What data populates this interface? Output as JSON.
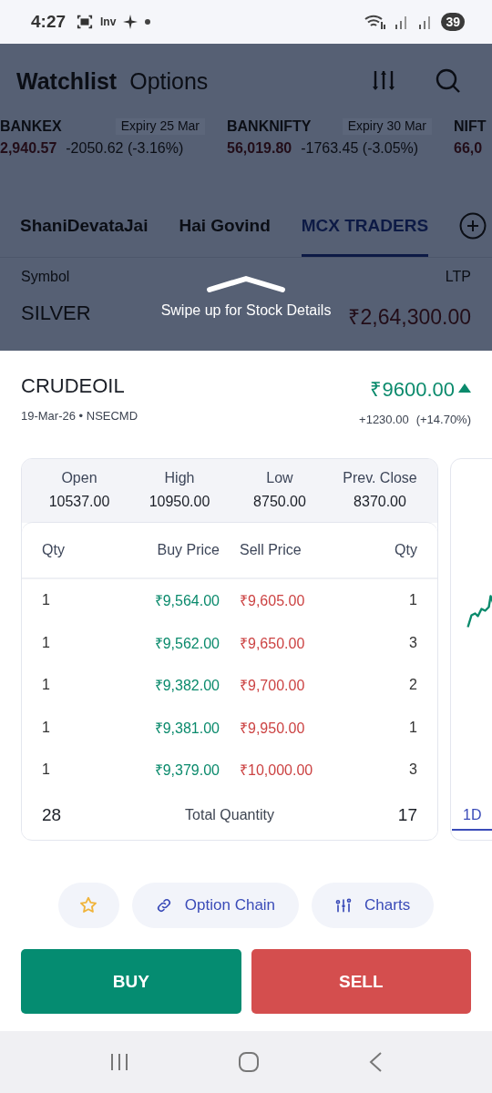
{
  "status_bar": {
    "time": "4:27",
    "app_badge": "Inv",
    "battery": "39"
  },
  "app_header": {
    "tabs": [
      {
        "label": "Watchlist",
        "selected": true
      },
      {
        "label": "Options",
        "selected": false
      }
    ]
  },
  "tickers": [
    {
      "symbol": "BANKEX",
      "expiry": "Expiry 25 Mar",
      "price": "2,940.57",
      "change": "-2050.62 (-3.16%)"
    },
    {
      "symbol": "BANKNIFTY",
      "expiry": "Expiry 30 Mar",
      "price": "56,019.80",
      "change": "-1763.45 (-3.05%)"
    },
    {
      "symbol": "NIFT",
      "price": "66,0"
    }
  ],
  "watchlist_tabs": [
    {
      "label": "ShaniDevataJai",
      "selected": false
    },
    {
      "label": "Hai Govind",
      "selected": false
    },
    {
      "label": "MCX TRADERS",
      "selected": true
    }
  ],
  "list_header": {
    "symbol": "Symbol",
    "ltp": "LTP"
  },
  "rows": [
    {
      "symbol": "SILVER",
      "ltp": "₹2,64,300.00"
    }
  ],
  "hint": "Swipe up for Stock Details",
  "sheet": {
    "name": "CRUDEOIL",
    "subtitle": "19-Mar-26 • NSECMD",
    "price": "₹9600.00",
    "trend_up": true,
    "change": "+1230.00",
    "change_pct": "(+14.70%)",
    "stats": [
      {
        "label": "Open",
        "value": "10537.00"
      },
      {
        "label": "High",
        "value": "10950.00"
      },
      {
        "label": "Low",
        "value": "8750.00"
      },
      {
        "label": "Prev. Close",
        "value": "8370.00"
      }
    ],
    "depth": {
      "columns": [
        "Qty",
        "Buy Price",
        "Sell Price",
        "Qty"
      ],
      "rows": [
        {
          "buy_qty": "1",
          "buy_price": "₹9,564.00",
          "sell_price": "₹9,605.00",
          "sell_qty": "1"
        },
        {
          "buy_qty": "1",
          "buy_price": "₹9,562.00",
          "sell_price": "₹9,650.00",
          "sell_qty": "3"
        },
        {
          "buy_qty": "1",
          "buy_price": "₹9,382.00",
          "sell_price": "₹9,700.00",
          "sell_qty": "2"
        },
        {
          "buy_qty": "1",
          "buy_price": "₹9,381.00",
          "sell_price": "₹9,950.00",
          "sell_qty": "1"
        },
        {
          "buy_qty": "1",
          "buy_price": "₹9,379.00",
          "sell_price": "₹10,000.00",
          "sell_qty": "3"
        }
      ],
      "total_buy": "28",
      "total_label": "Total Quantity",
      "total_sell": "17"
    },
    "chart": {
      "ranges": [
        {
          "label": "1D",
          "selected": true
        }
      ]
    },
    "actions": [
      {
        "kind": "watch"
      },
      {
        "kind": "link",
        "label": "Option Chain"
      },
      {
        "kind": "charts",
        "label": "Charts"
      }
    ],
    "buttons": [
      {
        "kind": "buy",
        "label": "BUY"
      },
      {
        "kind": "sell",
        "label": "SELL"
      }
    ]
  }
}
